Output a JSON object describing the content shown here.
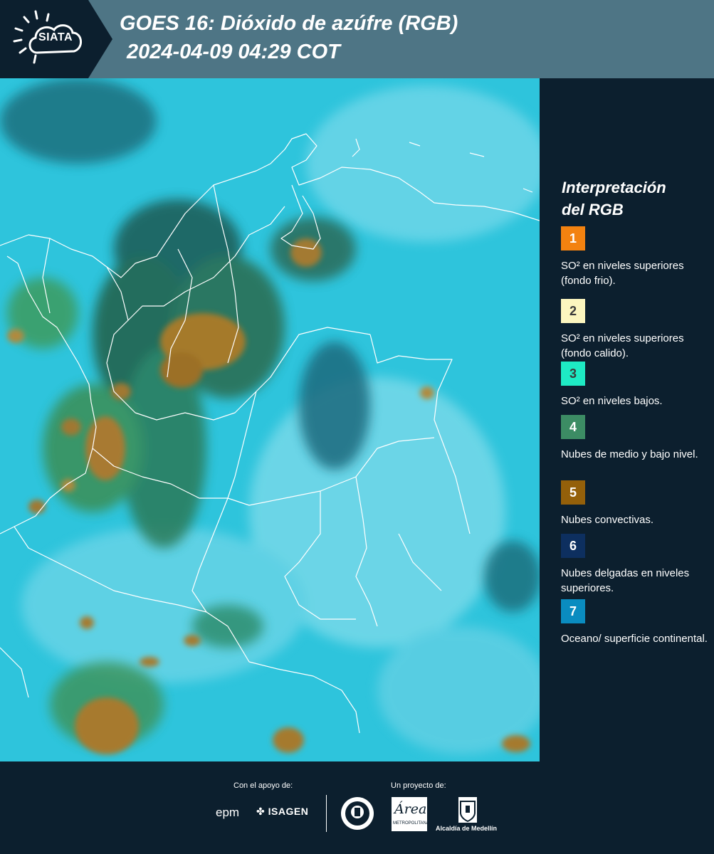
{
  "header": {
    "logo_text": "SIATA",
    "title": "GOES 16: Dióxido de azúfre (RGB)",
    "subtitle": "2024-04-09 04:29 COT"
  },
  "legend": {
    "title_line1": "Interpretación",
    "title_line2": "del RGB",
    "items": [
      {
        "number": "1",
        "color": "#f38210",
        "text": "SO² en niveles superiores (fondo frio)."
      },
      {
        "number": "2",
        "color": "#fcf6bf",
        "text": "SO² en niveles superiores (fondo calido)."
      },
      {
        "number": "3",
        "color": "#1eeac4",
        "text": "SO² en niveles bajos."
      },
      {
        "number": "4",
        "color": "#3c8c64",
        "text": "Nubes de medio y bajo nivel."
      },
      {
        "number": "5",
        "color": "#94600a",
        "text": "Nubes convectivas."
      },
      {
        "number": "6",
        "color": "#0d2f5f",
        "text": "Nubes delgadas en niveles superiores."
      },
      {
        "number": "7",
        "color": "#0a8cc0",
        "text": "Oceano/ superficie continental."
      }
    ]
  },
  "footer": {
    "support_label": "Con el apoyo de:",
    "project_label": "Un proyecto de:",
    "sponsor1": "epm",
    "sponsor2": "ISAGEN",
    "partner1_logo": "Área",
    "partner1_sub": "METROPOLITANA",
    "partner2": "Alcaldía de Medellín"
  },
  "colors": {
    "header_bg": "#4e7585",
    "panel_bg": "#0c1f2e",
    "map_base": "#2ec4dc"
  }
}
